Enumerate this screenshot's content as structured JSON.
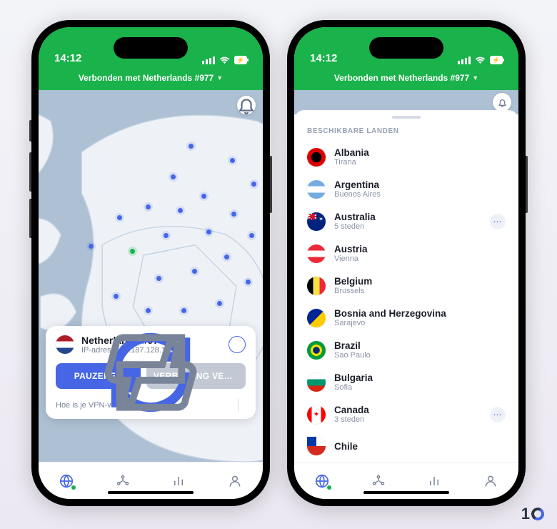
{
  "statusbar": {
    "time": "14:12"
  },
  "connection": {
    "banner": "Verbonden met Netherlands #977",
    "server_name": "Netherlands #977",
    "ip_label": "IP-adres: 193.187.128.165"
  },
  "buttons": {
    "pause": "PAUZEREN",
    "disconnect": "VERBINDING VERBR..."
  },
  "rating": {
    "question": "Hoe is je VPN-verbinding?"
  },
  "sheet": {
    "section_title": "BESCHIKBARE LANDEN"
  },
  "countries": [
    {
      "name": "Albania",
      "city": "Tirana",
      "flag": "fl-al",
      "more": false
    },
    {
      "name": "Argentina",
      "city": "Buenos Aires",
      "flag": "fl-ar",
      "more": false
    },
    {
      "name": "Australia",
      "city": "5 steden",
      "flag": "fl-au",
      "more": true
    },
    {
      "name": "Austria",
      "city": "Vienna",
      "flag": "fl-at",
      "more": false
    },
    {
      "name": "Belgium",
      "city": "Brussels",
      "flag": "fl-be",
      "more": false
    },
    {
      "name": "Bosnia and Herzegovina",
      "city": "Sarajevo",
      "flag": "fl-ba",
      "more": false
    },
    {
      "name": "Brazil",
      "city": "Sao Paulo",
      "flag": "fl-br",
      "more": false
    },
    {
      "name": "Bulgaria",
      "city": "Sofia",
      "flag": "fl-bg",
      "more": false
    },
    {
      "name": "Canada",
      "city": "3 steden",
      "flag": "fl-ca",
      "more": true
    },
    {
      "name": "Chile",
      "city": "",
      "flag": "fl-cl",
      "more": false
    }
  ],
  "brand": "1"
}
